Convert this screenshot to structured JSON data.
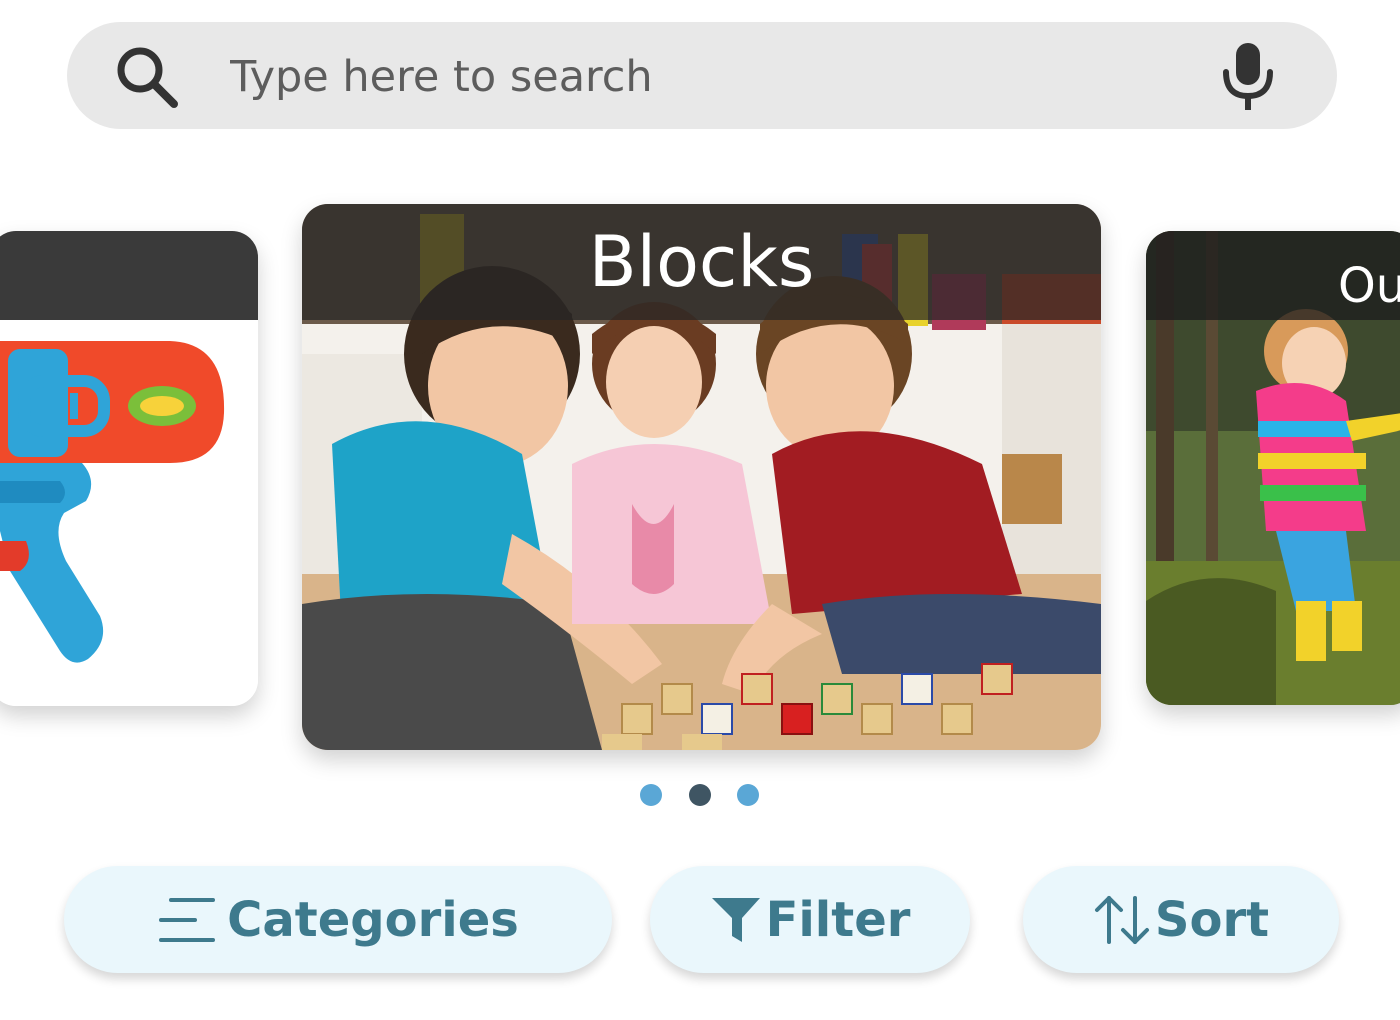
{
  "search": {
    "placeholder": "Type here to search",
    "search_icon": "search-icon",
    "mic_icon": "microphone-icon"
  },
  "carousel": {
    "cards": [
      {
        "title": ""
      },
      {
        "title": "Blocks"
      },
      {
        "title": "Ou"
      }
    ],
    "dots": 3,
    "active_index": 1
  },
  "actions": {
    "categories_label": "Categories",
    "categories_icon": "menu-lines-icon",
    "filter_label": "Filter",
    "filter_icon": "funnel-icon",
    "sort_label": "Sort",
    "sort_icon": "sort-arrows-icon"
  },
  "colors": {
    "search_bg": "#e8e8e8",
    "button_bg": "#eaf7fc",
    "button_text": "#3e7a8d",
    "dot_inactive": "#5aa7d6",
    "dot_active": "#3f5563"
  }
}
